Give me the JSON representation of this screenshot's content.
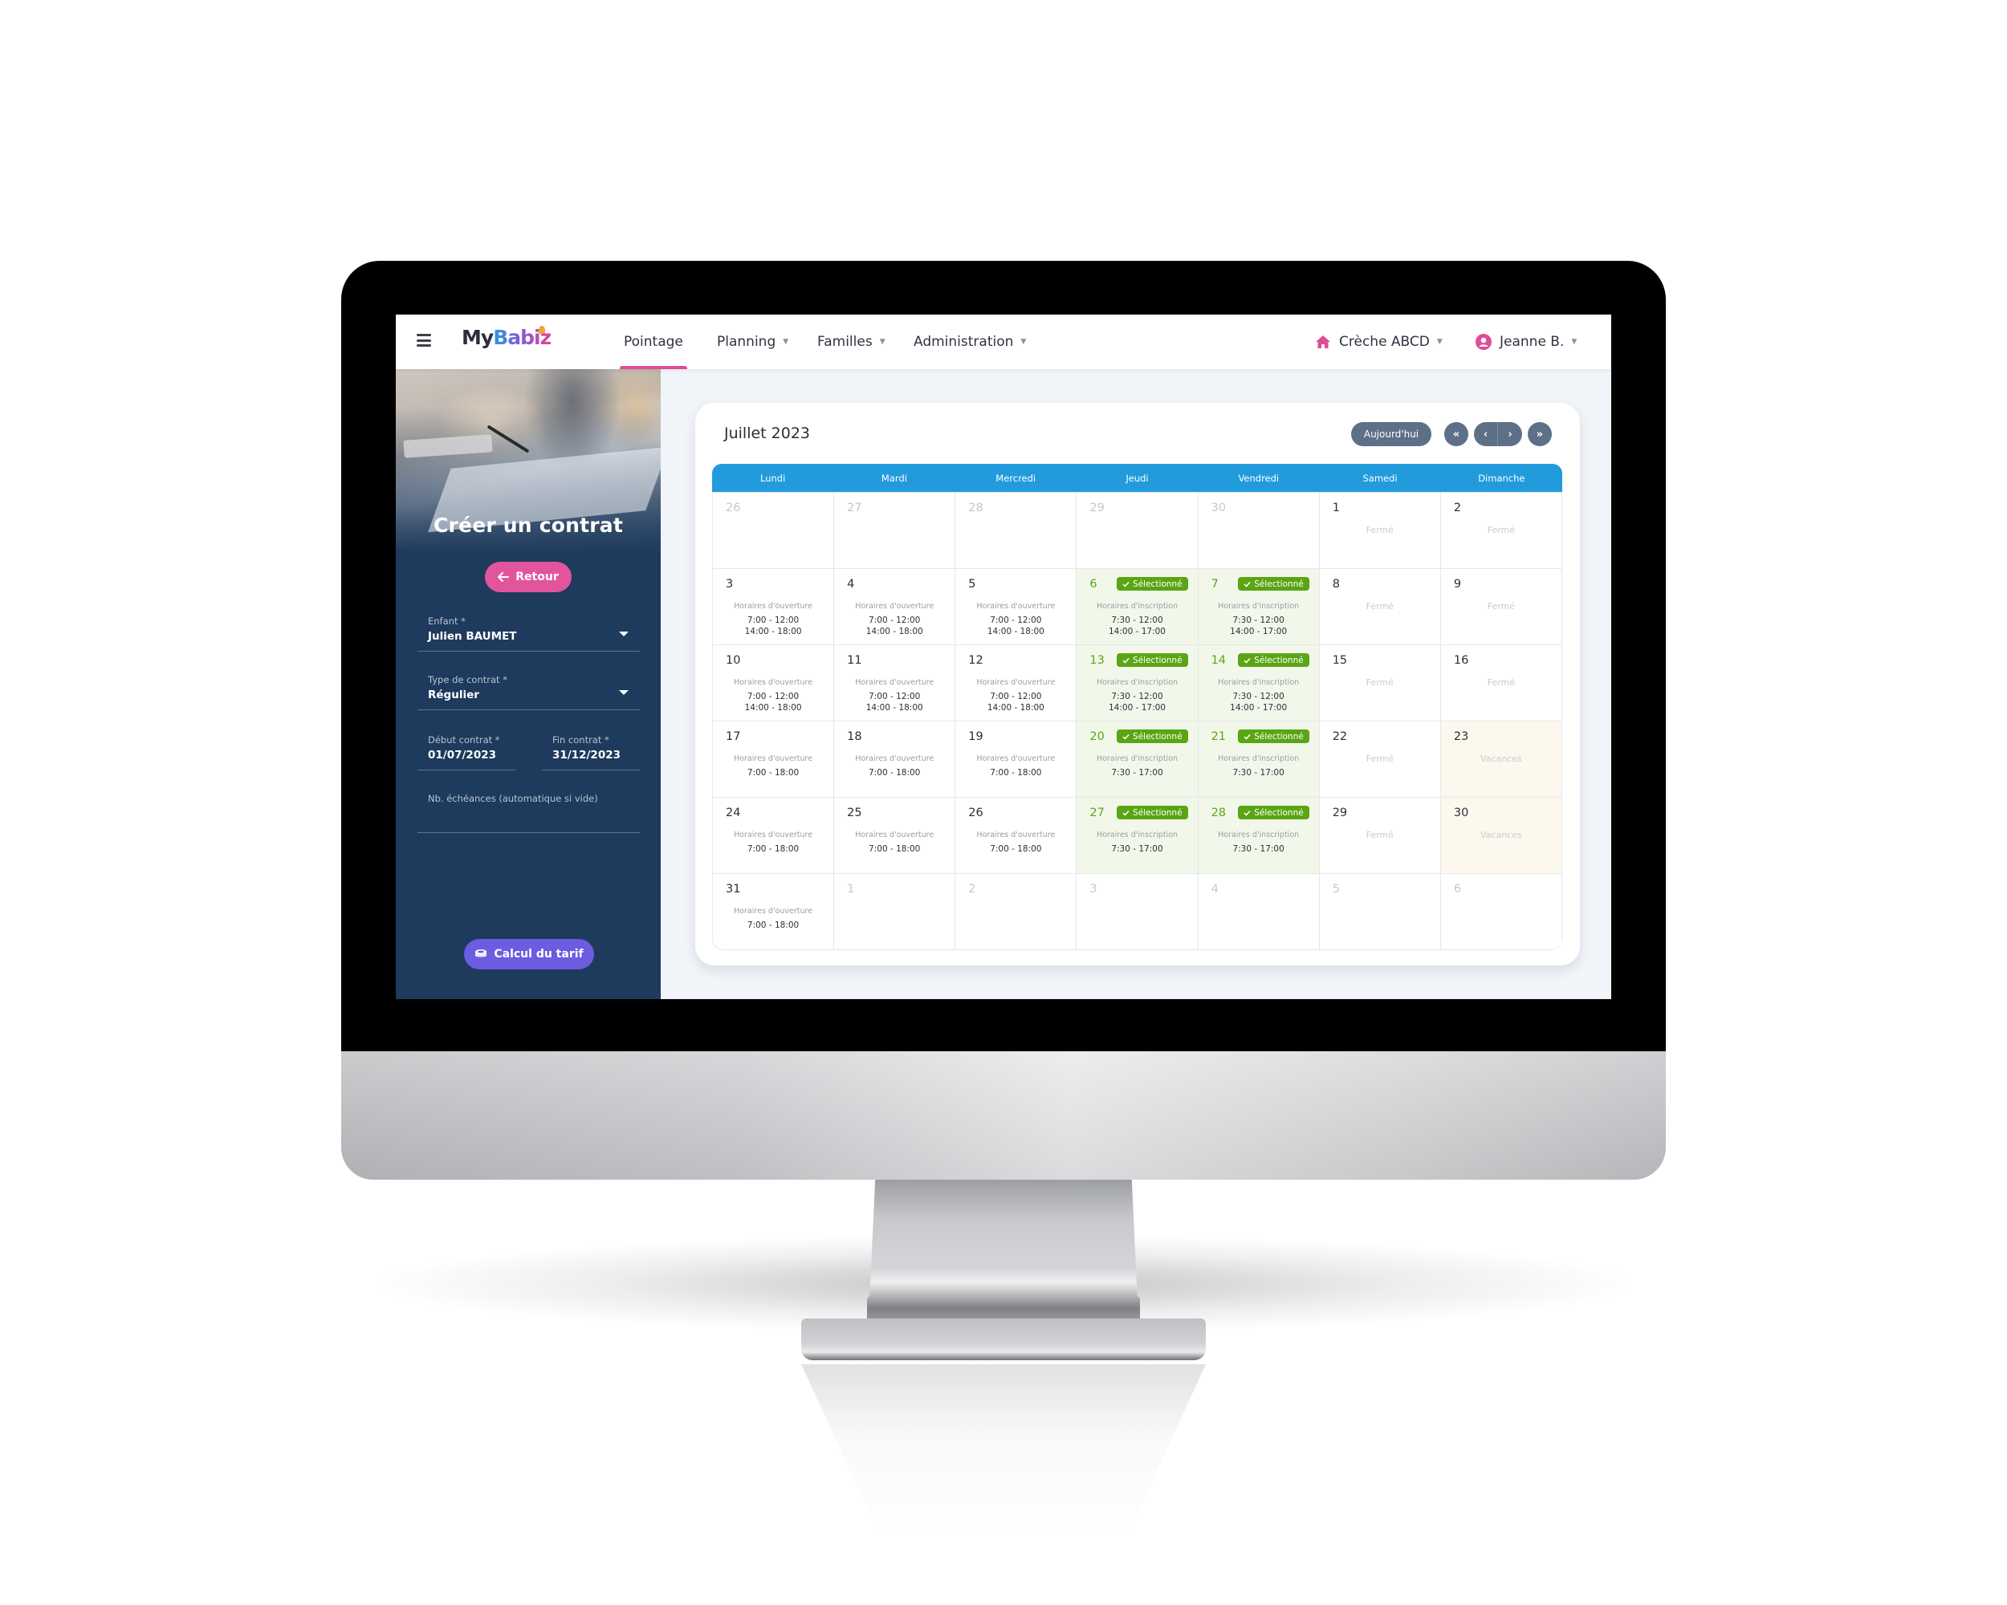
{
  "navbar": {
    "logo": {
      "part1": "My",
      "part2": "Babiz"
    },
    "items": [
      {
        "label": "Pointage",
        "active": true,
        "dropdown": false
      },
      {
        "label": "Planning",
        "active": false,
        "dropdown": true
      },
      {
        "label": "Familles",
        "active": false,
        "dropdown": true
      },
      {
        "label": "Administration",
        "active": false,
        "dropdown": true
      }
    ],
    "creche": {
      "label": "Crèche ABCD",
      "icon": "home-icon"
    },
    "user": {
      "label": "Jeanne B.",
      "icon": "user-circle-icon"
    },
    "caret": "▼",
    "accent_color": "#e04c95"
  },
  "sidebar": {
    "title": "Créer un contrat",
    "back_button": {
      "label": "Retour",
      "icon": "arrow-left-icon"
    },
    "fields": {
      "enfant": {
        "label": "Enfant *",
        "value": "Julien BAUMET"
      },
      "type": {
        "label": "Type de contrat *",
        "value": "Régulier"
      },
      "debut": {
        "label": "Début contrat *",
        "value": "01/07/2023"
      },
      "fin": {
        "label": "Fin contrat *",
        "value": "31/12/2023"
      },
      "nb": {
        "label": "Nb. échéances (automatique si vide)",
        "value": ""
      }
    },
    "calc_button": {
      "label": "Calcul du tarif",
      "icon": "coins-icon"
    },
    "bg_color": "#1e3a5c"
  },
  "calendar": {
    "title": "Juillet 2023",
    "today_label": "Aujourd'hui",
    "nav": {
      "first": "«",
      "prev": "‹",
      "next": "›",
      "last": "»"
    },
    "weekdays": [
      "Lundi",
      "Mardi",
      "Mercredi",
      "Jeudi",
      "Vendredi",
      "Samedi",
      "Dimanche"
    ],
    "selected_label": "Sélectionné",
    "header_color": "#229bdd",
    "selected_color": "#5aa514",
    "days": [
      {
        "day": "26",
        "state": "out"
      },
      {
        "day": "27",
        "state": "out"
      },
      {
        "day": "28",
        "state": "out"
      },
      {
        "day": "29",
        "state": "out"
      },
      {
        "day": "30",
        "state": "out"
      },
      {
        "day": "1",
        "state": "closed",
        "note": "Fermé"
      },
      {
        "day": "2",
        "state": "closed",
        "note": "Fermé"
      },
      {
        "day": "3",
        "state": "open",
        "sub": "Horaires d'ouverture",
        "hours": [
          "7:00 - 12:00",
          "14:00 - 18:00"
        ]
      },
      {
        "day": "4",
        "state": "open",
        "sub": "Horaires d'ouverture",
        "hours": [
          "7:00 - 12:00",
          "14:00 - 18:00"
        ]
      },
      {
        "day": "5",
        "state": "open",
        "sub": "Horaires d'ouverture",
        "hours": [
          "7:00 - 12:00",
          "14:00 - 18:00"
        ]
      },
      {
        "day": "6",
        "state": "selected",
        "sub": "Horaires d'inscription",
        "hours": [
          "7:30 - 12:00",
          "14:00 - 17:00"
        ]
      },
      {
        "day": "7",
        "state": "selected",
        "sub": "Horaires d'inscription",
        "hours": [
          "7:30 - 12:00",
          "14:00 - 17:00"
        ]
      },
      {
        "day": "8",
        "state": "closed",
        "note": "Fermé"
      },
      {
        "day": "9",
        "state": "closed",
        "note": "Fermé"
      },
      {
        "day": "10",
        "state": "open",
        "sub": "Horaires d'ouverture",
        "hours": [
          "7:00 - 12:00",
          "14:00 - 18:00"
        ]
      },
      {
        "day": "11",
        "state": "open",
        "sub": "Horaires d'ouverture",
        "hours": [
          "7:00 - 12:00",
          "14:00 - 18:00"
        ]
      },
      {
        "day": "12",
        "state": "open",
        "sub": "Horaires d'ouverture",
        "hours": [
          "7:00 - 12:00",
          "14:00 - 18:00"
        ]
      },
      {
        "day": "13",
        "state": "selected",
        "sub": "Horaires d'inscription",
        "hours": [
          "7:30 - 12:00",
          "14:00 - 17:00"
        ]
      },
      {
        "day": "14",
        "state": "selected",
        "sub": "Horaires d'inscription",
        "hours": [
          "7:30 - 12:00",
          "14:00 - 17:00"
        ]
      },
      {
        "day": "15",
        "state": "closed",
        "note": "Fermé"
      },
      {
        "day": "16",
        "state": "closed",
        "note": "Fermé"
      },
      {
        "day": "17",
        "state": "open",
        "sub": "Horaires d'ouverture",
        "hours": [
          "7:00 - 18:00"
        ]
      },
      {
        "day": "18",
        "state": "open",
        "sub": "Horaires d'ouverture",
        "hours": [
          "7:00 - 18:00"
        ]
      },
      {
        "day": "19",
        "state": "open",
        "sub": "Horaires d'ouverture",
        "hours": [
          "7:00 - 18:00"
        ]
      },
      {
        "day": "20",
        "state": "selected",
        "sub": "Horaires d'inscription",
        "hours": [
          "7:30 - 17:00"
        ]
      },
      {
        "day": "21",
        "state": "selected",
        "sub": "Horaires d'inscription",
        "hours": [
          "7:30 - 17:00"
        ]
      },
      {
        "day": "22",
        "state": "closed",
        "note": "Fermé"
      },
      {
        "day": "23",
        "state": "vacation",
        "note": "Vacances"
      },
      {
        "day": "24",
        "state": "open",
        "sub": "Horaires d'ouverture",
        "hours": [
          "7:00 - 18:00"
        ]
      },
      {
        "day": "25",
        "state": "open",
        "sub": "Horaires d'ouverture",
        "hours": [
          "7:00 - 18:00"
        ]
      },
      {
        "day": "26",
        "state": "open",
        "sub": "Horaires d'ouverture",
        "hours": [
          "7:00 - 18:00"
        ]
      },
      {
        "day": "27",
        "state": "selected",
        "sub": "Horaires d'inscription",
        "hours": [
          "7:30 - 17:00"
        ]
      },
      {
        "day": "28",
        "state": "selected",
        "sub": "Horaires d'inscription",
        "hours": [
          "7:30 - 17:00"
        ]
      },
      {
        "day": "29",
        "state": "closed",
        "note": "Fermé"
      },
      {
        "day": "30",
        "state": "vacation",
        "note": "Vacances"
      },
      {
        "day": "31",
        "state": "open",
        "sub": "Horaires d'ouverture",
        "hours": [
          "7:00 - 18:00"
        ]
      },
      {
        "day": "1",
        "state": "out"
      },
      {
        "day": "2",
        "state": "out"
      },
      {
        "day": "3",
        "state": "out"
      },
      {
        "day": "4",
        "state": "out"
      },
      {
        "day": "5",
        "state": "out"
      },
      {
        "day": "6",
        "state": "out"
      }
    ]
  }
}
